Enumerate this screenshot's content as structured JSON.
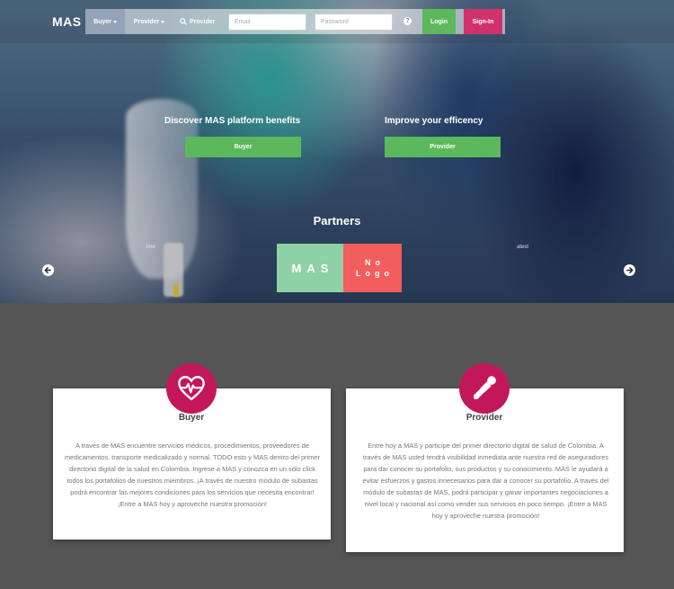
{
  "navbar": {
    "brand": "MAS",
    "buyer_menu": "Buyer",
    "provider_menu": "Provider",
    "provider_search": "Provider",
    "email_placeholder": "Email",
    "password_placeholder": "Password",
    "help_icon": "?",
    "login_label": "Login",
    "signin_label": "Sign-In"
  },
  "hero": {
    "benefits_heading": "Discover MAS platform benefits",
    "efficiency_heading": "Improve your efficency",
    "buyer_button": "Buyer",
    "provider_button": "Provider"
  },
  "partners": {
    "title": "Partners",
    "caption_left": "ime",
    "caption_right": "atest",
    "logo_mas": "MAS",
    "logo_nologo": "No Logo"
  },
  "cards": {
    "buyer": {
      "title": "Buyer",
      "text": "A través de MAS encuentre servicios médicos, procedimientos, proveedores de medicamentos, transporte medicalizado y normal. TODO esto y MAS dentro del primer directorio digital de la salud en Colombia. Ingrese a MAS y conozca en un sólo click todos los portafolios de nuestros miembros. ¡A través de nuestro módulo de subastas podrá encontrar las mejores condiciones para los servicios que necesita encontrar! ¡Entre a MAS hoy y aproveche nuestra promoción!"
    },
    "provider": {
      "title": "Provider",
      "text": "Entre hoy a MAS y participe del primer directorio digital de salud de Colombia. A través de MAS usted tendrá visibilidad inmediata ante nuestra red de aseguradores para dar conocer su portafolio, sus productos y su conocimiento. MAS le ayudará a evitar esfuerzos y gastos innecesarios para dar a conocer su portafolio. A través del módulo de subastas de MAS, podrá participar y ganar importantes negociaciones a nivel local y nacional así como vender sus servicios en poco tiempo. ¡Entre a MAS hoy y aproveche nuestra promoción!"
    }
  },
  "colors": {
    "green": "#5cb85c",
    "pink": "#d0336b",
    "icon_circle": "#c2185b",
    "gray_section": "#555555",
    "mas_logo": "#8fd1a6",
    "nologo_logo": "#f25d5d"
  },
  "icons": {
    "search": "search-icon",
    "help": "question-circle-icon",
    "prev": "arrow-left-circle-icon",
    "next": "arrow-right-circle-icon",
    "buyer": "heart-pulse-icon",
    "provider": "dropper-icon"
  }
}
